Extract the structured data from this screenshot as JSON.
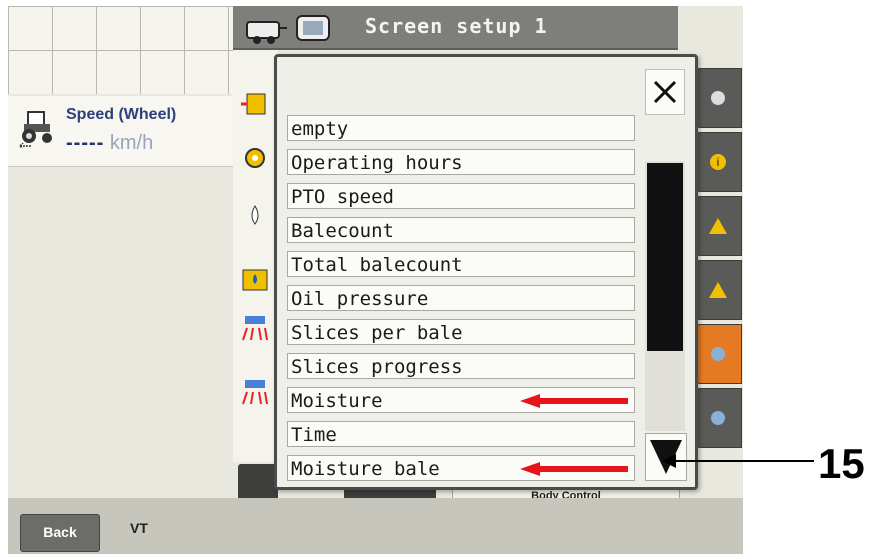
{
  "header": {
    "title": "Screen setup 1"
  },
  "speed_panel": {
    "label": "Speed (Wheel)",
    "value": "-----",
    "unit": "km/h"
  },
  "dialog": {
    "close_symbol": "×",
    "items": [
      "empty",
      "Operating hours",
      "PTO speed",
      "Balecount",
      "Total balecount",
      "Oil pressure",
      "Slices per bale",
      "Slices progress",
      "Moisture",
      "Time",
      "Moisture bale"
    ],
    "highlighted_items": [
      "Moisture",
      "Moisture bale"
    ]
  },
  "bottom_bar": {
    "back_label": "Back",
    "vt_label": "VT",
    "body_control_label": "Body Control"
  },
  "callout": {
    "number": "15"
  },
  "colors": {
    "arrow": "#e8141c",
    "active_softkey": "#e57a25",
    "header": "#7e7e7b"
  },
  "icons": [
    "tractor-icon",
    "baler-icon",
    "terminal-icon",
    "close-icon",
    "scroll-down-icon",
    "info-icon",
    "warning-icon",
    "settings-icon"
  ]
}
